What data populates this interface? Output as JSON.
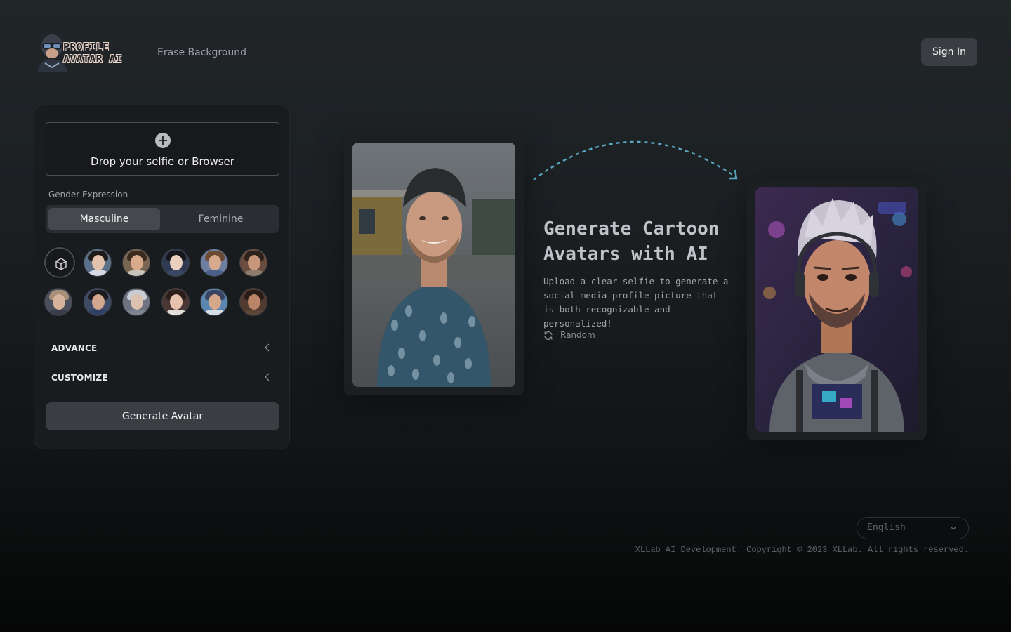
{
  "header": {
    "logo_line1": "PROFILE",
    "logo_line2": "AVATAR AI",
    "nav_link": "Erase Background",
    "signin_label": "Sign In"
  },
  "panel": {
    "drop_text": "Drop your selfie or ",
    "drop_link": "Browser",
    "gender_label": "Gender Expression",
    "gender_options": [
      "Masculine",
      "Feminine"
    ],
    "gender_selected": "Masculine",
    "avatar_icons": [
      "cube-icon"
    ],
    "advance_label": "ADVANCE",
    "customize_label": "CUSTOMIZE",
    "generate_label": "Generate Avatar"
  },
  "hero": {
    "headline": "Generate Cartoon Avatars with AI",
    "subtext": "Upload a clear selfie to generate a social media profile picture that is both recognizable and personalized!",
    "random_label": "Random"
  },
  "footer": {
    "language": "English",
    "copyright": "XLLab AI Development. Copyright © 2023 XLLab. All rights reserved."
  },
  "colors": {
    "accent_arrow": "#5aa8c4",
    "button_bg": "#3a3d42",
    "panel_bg": "#191c1f"
  }
}
